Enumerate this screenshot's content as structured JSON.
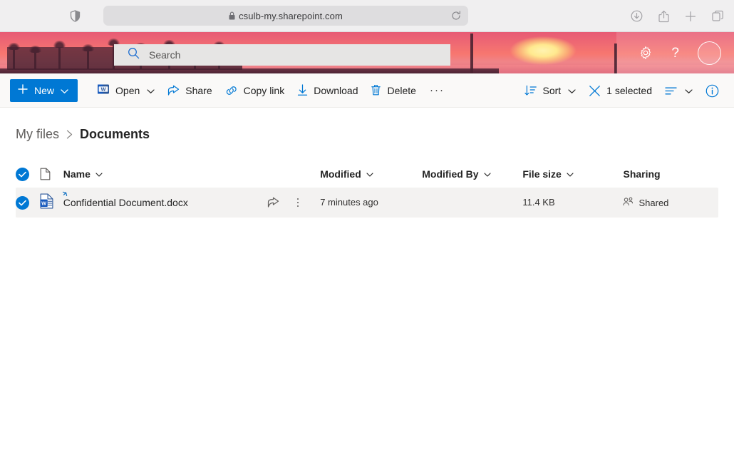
{
  "browser": {
    "url": "csulb-my.sharepoint.com",
    "shield_icon": "shield-icon",
    "lock_icon": "lock-icon",
    "reload_icon": "reload-icon",
    "right_icons": [
      "downloads-icon",
      "share-icon",
      "new-tab-icon",
      "tab-overview-icon"
    ]
  },
  "suite_header": {
    "search": {
      "placeholder": "Search",
      "icon": "search-icon"
    },
    "settings_icon": "gear-icon",
    "help_icon": "help-icon",
    "help_glyph": "?",
    "avatar": "avatar"
  },
  "command_bar": {
    "new_label": "New",
    "commands": [
      {
        "label": "Open",
        "icon": "word-app-icon",
        "has_chevron": true
      },
      {
        "label": "Share",
        "icon": "share-icon",
        "has_chevron": false
      },
      {
        "label": "Copy link",
        "icon": "link-icon",
        "has_chevron": false
      },
      {
        "label": "Download",
        "icon": "download-icon",
        "has_chevron": false
      },
      {
        "label": "Delete",
        "icon": "trash-icon",
        "has_chevron": false
      }
    ],
    "overflow_label": "···",
    "sort_label": "Sort",
    "selection_label": "1 selected",
    "view_icon": "view-options-icon",
    "info_icon": "info-icon",
    "accent_color": "#0078d4"
  },
  "breadcrumb": {
    "parent": "My files",
    "separator": "›",
    "current": "Documents"
  },
  "file_list": {
    "columns": [
      {
        "label": "Name",
        "sortable": true
      },
      {
        "label": "Modified",
        "sortable": true
      },
      {
        "label": "Modified By",
        "sortable": true
      },
      {
        "label": "File size",
        "sortable": true
      },
      {
        "label": "Sharing",
        "sortable": false
      }
    ],
    "rows": [
      {
        "selected": true,
        "file_icon": "word-file-icon",
        "name": "Confidential Document.docx",
        "modified": "7 minutes ago",
        "modified_by": "",
        "size": "11.4 KB",
        "sharing": "Shared",
        "sharing_icon": "people-icon"
      }
    ]
  }
}
